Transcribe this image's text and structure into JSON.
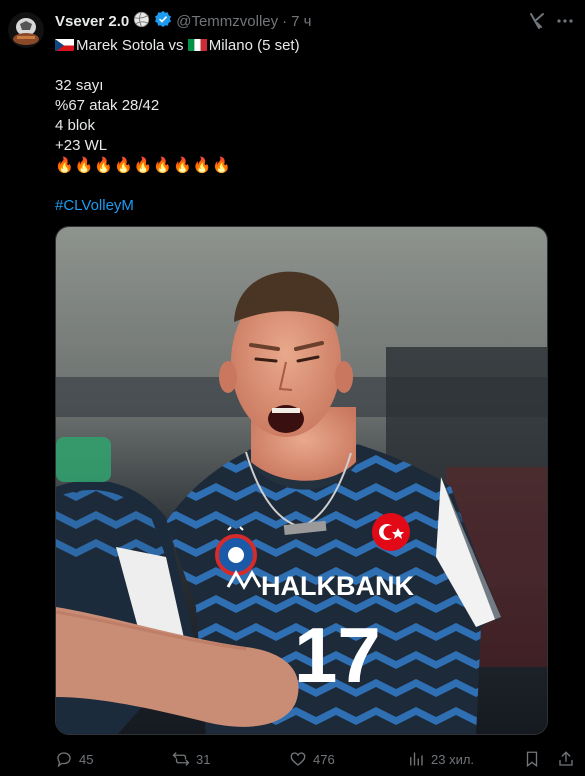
{
  "author": {
    "display_name": "Vsever 2.0",
    "handle": "@Temmzvolley",
    "separator": "·",
    "time": "7 ч",
    "avatar_icon": "soccer-ball-avatar",
    "name_badge_icon": "volleyball-icon",
    "verified_icon": "verified-badge-icon",
    "verified_color": "#1d9bf0"
  },
  "header_actions": {
    "grok_icon": "grok-icon",
    "more_icon": "more-dots-icon"
  },
  "tweet": {
    "line1_player": "Marek Sotola",
    "line1_vs": "vs",
    "line1_team": "Milano (5 set)",
    "stat1": "32 sayı",
    "stat2": "%67 atak 28/42",
    "stat3": "4 blok",
    "stat4": "+23 WL",
    "fires": "🔥🔥🔥🔥🔥🔥🔥🔥🔥",
    "hashtag": "#CLVolleyM",
    "hashtag_color": "#1d9bf0"
  },
  "media": {
    "jersey_brand": "HALKBANK",
    "jersey_number": "17",
    "description_icon": "volleyball-player-photo"
  },
  "actions": {
    "replies": "45",
    "reposts": "31",
    "likes": "476",
    "views": "23 хил."
  }
}
